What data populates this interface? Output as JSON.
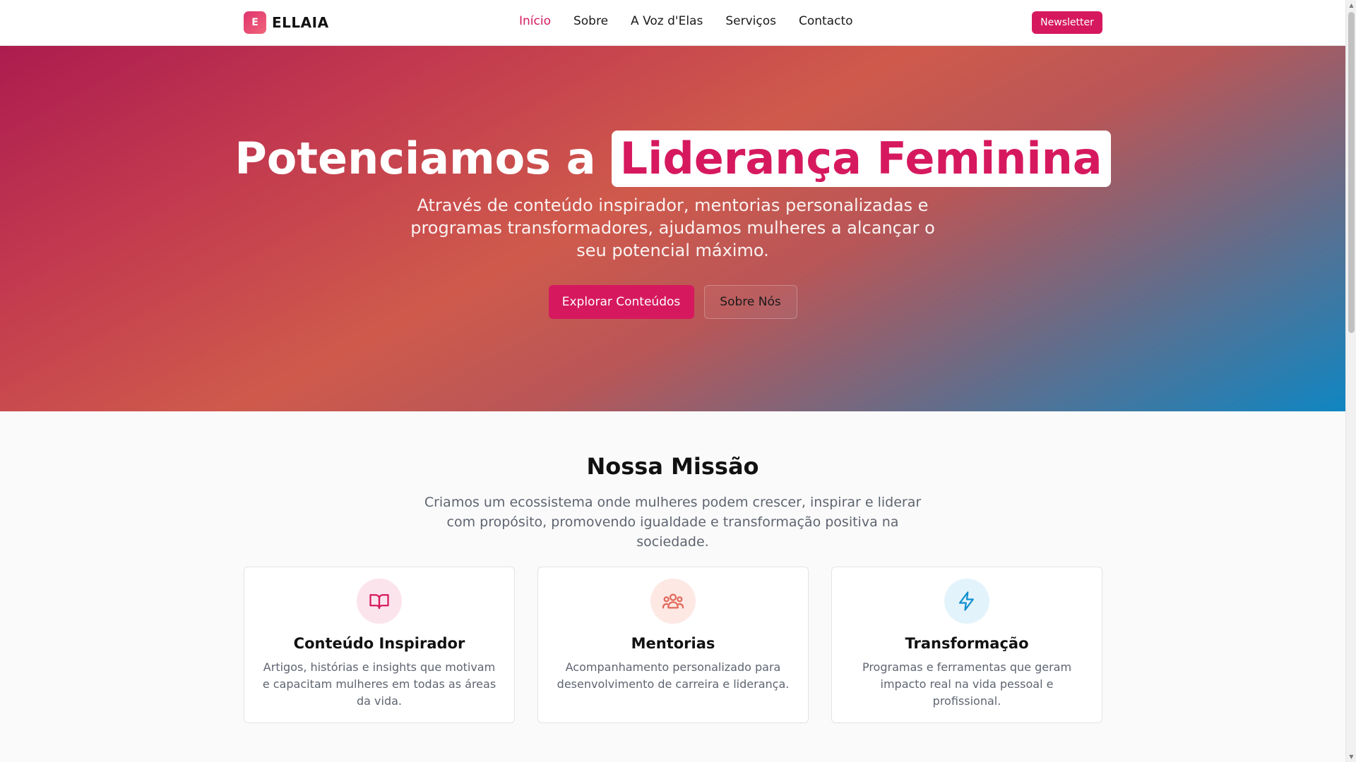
{
  "brand": {
    "mark": "E",
    "name": "ELLAIA"
  },
  "nav": {
    "items": [
      {
        "label": "Início",
        "active": true
      },
      {
        "label": "Sobre",
        "active": false
      },
      {
        "label": "A Voz d'Elas",
        "active": false
      },
      {
        "label": "Serviços",
        "active": false
      },
      {
        "label": "Contacto",
        "active": false
      }
    ],
    "newsletter_label": "Newsletter"
  },
  "hero": {
    "title_lead": "Potenciamos a",
    "title_highlight": "Liderança Feminina",
    "subtitle": "Através de conteúdo inspirador, mentorias personalizadas e programas transformadores, ajudamos mulheres a alcançar o seu potencial máximo.",
    "primary_button": "Explorar Conteúdos",
    "secondary_button": "Sobre Nós"
  },
  "mission": {
    "title": "Nossa Missão",
    "text": "Criamos um ecossistema onde mulheres podem crescer, inspirar e liderar com propósito, promovendo igualdade e transformação positiva na sociedade.",
    "cards": [
      {
        "icon": "book-open-icon",
        "title": "Conteúdo Inspirador",
        "text": "Artigos, histórias e insights que motivam e capacitam mulheres em todas as áreas da vida."
      },
      {
        "icon": "users-icon",
        "title": "Mentorias",
        "text": "Acompanhamento personalizado para desenvolvimento de carreira e liderança."
      },
      {
        "icon": "lightning-icon",
        "title": "Transformação",
        "text": "Programas e ferramentas que geram impacto real na vida pessoal e profissional."
      }
    ]
  },
  "colors": {
    "accent": "#d6195e",
    "icon_pink": "#d6195e",
    "icon_coral": "#e2685a",
    "icon_blue": "#0f8fcf"
  }
}
